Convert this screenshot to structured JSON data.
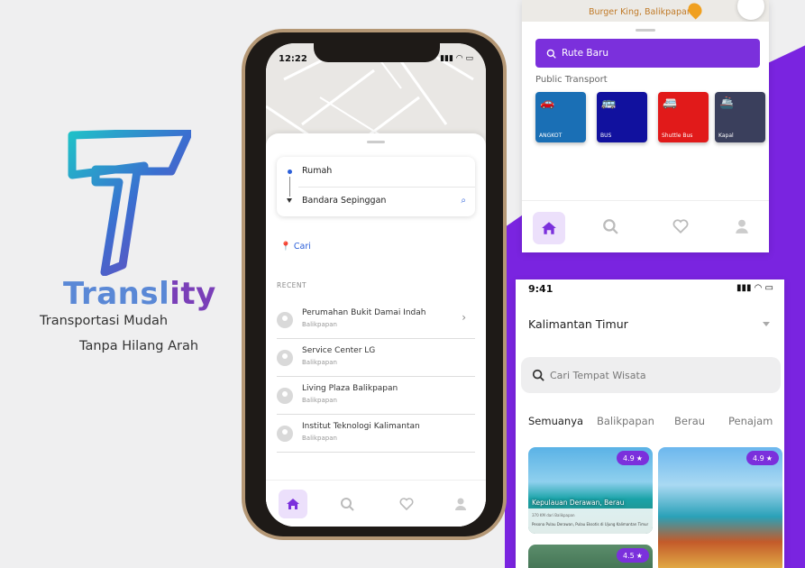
{
  "brand": {
    "name_main": "Transl",
    "name_tail": "ity",
    "tagline_1": "Transportasi Mudah",
    "tagline_2": "Tanpa Hilang Arah"
  },
  "phone": {
    "status_time": "12:22",
    "route": {
      "from": "Rumah",
      "to": "Bandara Sepinggan"
    },
    "search_action": "Cari",
    "recent_heading": "RECENT",
    "recent": [
      {
        "title": "Perumahan Bukit Damai Indah",
        "subtitle": "Balikpapan"
      },
      {
        "title": "Service Center LG",
        "subtitle": "Balikpapan"
      },
      {
        "title": "Living Plaza Balikpapan",
        "subtitle": "Balikpapan"
      },
      {
        "title": "Institut Teknologi Kalimantan",
        "subtitle": "Balikpapan"
      }
    ]
  },
  "transport_card": {
    "map_place": "Burger King, Balikpapan",
    "new_route": "Rute Baru",
    "section_title": "Public Transport",
    "modes": [
      {
        "label": "ANGKOT",
        "color": "#1a6fb5",
        "icon": "car-icon"
      },
      {
        "label": "BUS",
        "color": "#11119e",
        "icon": "bus-icon"
      },
      {
        "label": "Shuttle Bus",
        "color": "#e11a1a",
        "icon": "shuttle-icon"
      },
      {
        "label": "Kapal",
        "color": "#3a3f5c",
        "icon": "ship-icon"
      }
    ]
  },
  "tourism_card": {
    "status_time": "9:41",
    "region": "Kalimantan Timur",
    "search_placeholder": "Cari Tempat Wisata",
    "tabs": [
      "Semuanya",
      "Balikpapan",
      "Berau",
      "Penajam"
    ],
    "places": [
      {
        "title": "Kepulauan Derawan, Berau",
        "rating": "4.9",
        "meta": "370 KM dari Balikpapan",
        "desc": "Pesona Pulau Derawan, Pulau Eksotis di Ujung Kalimantan Timur"
      },
      {
        "rating": "4.9"
      },
      {
        "rating": "4.5"
      }
    ]
  },
  "colors": {
    "accent": "#7b30dc",
    "link": "#2b5fd9"
  }
}
